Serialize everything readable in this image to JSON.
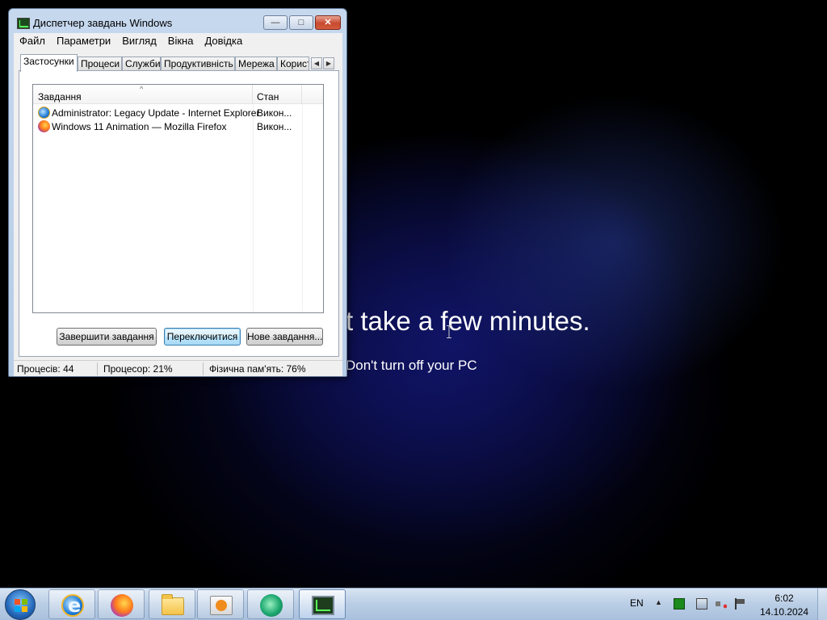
{
  "desktop": {
    "message_main": "t take a few minutes.",
    "message_sub": "Don't turn off your PC"
  },
  "window": {
    "title": "Диспетчер завдань Windows",
    "caption_buttons": {
      "minimize": "—",
      "maximize": "□",
      "close": "✕"
    },
    "menu": [
      "Файл",
      "Параметри",
      "Вигляд",
      "Вікна",
      "Довідка"
    ],
    "tabs": [
      "Застосунки",
      "Процеси",
      "Служби",
      "Продуктивність",
      "Мережа",
      "Корист"
    ],
    "active_tab": "Застосунки",
    "tab_scroll": {
      "left": "◀",
      "right": "▶"
    },
    "list": {
      "sort_glyph": "^",
      "columns": [
        "Завдання",
        "Стан"
      ],
      "rows": [
        {
          "icon": "internet-explorer-icon",
          "task": "Administrator: Legacy Update - Internet Explorer",
          "state": "Викон..."
        },
        {
          "icon": "firefox-icon",
          "task": "Windows 11 Animation — Mozilla Firefox",
          "state": "Викон..."
        }
      ]
    },
    "buttons": {
      "end_task": "Завершити завдання",
      "switch_to": "Переключитися",
      "new_task": "Нове завдання..."
    },
    "status": {
      "processes": "Процесів: 44",
      "cpu": "Процесор: 21%",
      "memory": "Фізична пам'ять: 76%"
    }
  },
  "taskbar": {
    "pinned": [
      "start-button",
      "internet-explorer-icon",
      "firefox-icon",
      "explorer-folder-icon",
      "media-center-icon",
      "media-player-icon",
      "task-manager-icon"
    ],
    "language": "EN",
    "tray_arrow": "▲",
    "clock_time": "6:02",
    "clock_date": "14.10.2024"
  }
}
